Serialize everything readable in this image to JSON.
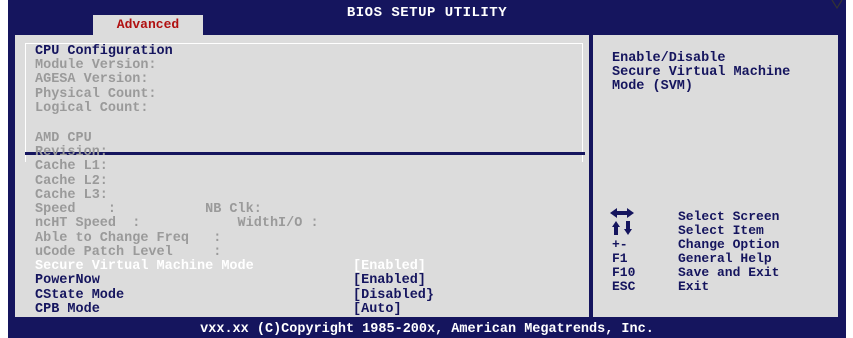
{
  "title": "BIOS SETUP UTILITY",
  "tab": "Advanced",
  "info_top": {
    "header": "CPU Configuration",
    "lines": [
      "Module Version:",
      "AGESA Version:",
      "Physical Count:",
      "Logical Count:"
    ]
  },
  "info_bottom": [
    "AMD CPU",
    "Revision:",
    "Cache L1:",
    "Cache L2:",
    "Cache L3:",
    "Speed    :           NB Clk:",
    "ncHT Speed  :            WidthI/O :",
    "Able to Change Freq   :",
    "uCode Patch Level     :"
  ],
  "options": [
    {
      "label": "Secure Virtual Machine Mode",
      "value": "[Enabled]"
    },
    {
      "label": "PowerNow",
      "value": "[Enabled]"
    },
    {
      "label": "CState Mode",
      "value": "[Disabled}"
    },
    {
      "label": "CPB Mode",
      "value": "[Auto]"
    }
  ],
  "help": [
    "Enable/Disable",
    "Secure Virtual Machine",
    "Mode (SVM)"
  ],
  "keys": [
    {
      "key": "",
      "desc": "Select Screen",
      "icon": "arrows-lr-icon"
    },
    {
      "key": "",
      "desc": "Select Item",
      "icon": "arrows-ud-icon"
    },
    {
      "key": "+-",
      "desc": "Change Option"
    },
    {
      "key": "F1",
      "desc": "General Help"
    },
    {
      "key": "F10",
      "desc": "Save and Exit"
    },
    {
      "key": "ESC",
      "desc": "Exit"
    }
  ],
  "footer": "vxx.xx (C)Copyright 1985-200x, American Megatrends, Inc.",
  "colors": {
    "frame": "#15155e",
    "panel": "#dcdcdc",
    "dim_text": "#9a9a9a",
    "selected": "#ffffff",
    "tab_text": "#b01010"
  }
}
